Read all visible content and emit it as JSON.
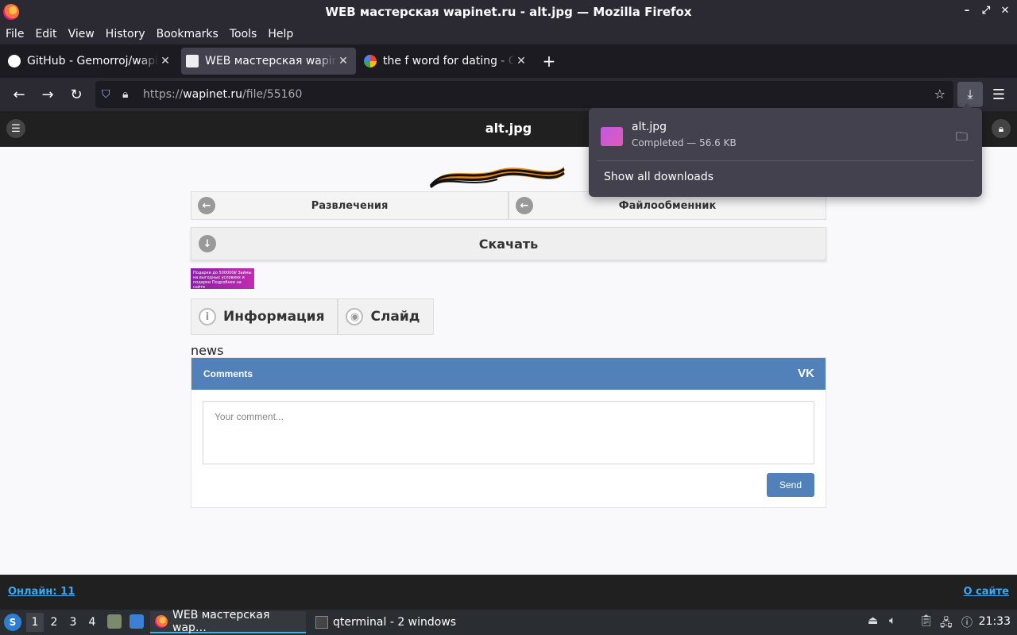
{
  "window": {
    "title": "WEB мастерская wapinet.ru - alt.jpg — Mozilla Firefox",
    "controls": [
      "–",
      "⤢",
      "✕"
    ]
  },
  "menubar": [
    "File",
    "Edit",
    "View",
    "History",
    "Bookmarks",
    "Tools",
    "Help"
  ],
  "tabs": [
    {
      "label": "GitHub - Gemorroj/wapinet",
      "icon": "github-icon"
    },
    {
      "label": "WEB мастерская wapinet.ru",
      "icon": "wapinet-icon",
      "active": true
    },
    {
      "label": "the f word for dating - Google",
      "icon": "google-icon"
    }
  ],
  "navbar": {
    "url_proto": "https://",
    "url_host": "wapinet.ru",
    "url_path": "/file/55160"
  },
  "page": {
    "header_title": "alt.jpg",
    "nav_left": "Развлечения",
    "nav_right": "Файлообменник",
    "download_label": "Скачать",
    "banner_text": "Подарки до 500000₽ Займы на выгодных условиях и подарки Подробнее на сайте",
    "info_tab": "Информация",
    "slide_tab": "Слайд",
    "news_label": "news",
    "comments": {
      "title": "Comments",
      "vk_logo": "VK",
      "placeholder": "Your comment...",
      "send_label": "Send"
    },
    "footer_online": "Онлайн: 11",
    "footer_about": "О сайте"
  },
  "downloads_panel": {
    "file_name": "alt.jpg",
    "status": "Completed — 56.6 KB",
    "show_all": "Show all downloads"
  },
  "taskbar": {
    "workspaces": [
      "1",
      "2",
      "3",
      "4"
    ],
    "tasks": [
      {
        "label": "WEB мастерская wap…",
        "icon": "firefox-icon",
        "active": true
      },
      {
        "label": "qterminal - 2 windows",
        "icon": "terminal-icon"
      }
    ],
    "clock": "21:33"
  },
  "colors": {
    "firefox_chrome": "#2b2a33",
    "tabstrip": "#1c1b22",
    "vk_blue": "#5181b8",
    "link_blue": "#3aa8f0"
  }
}
